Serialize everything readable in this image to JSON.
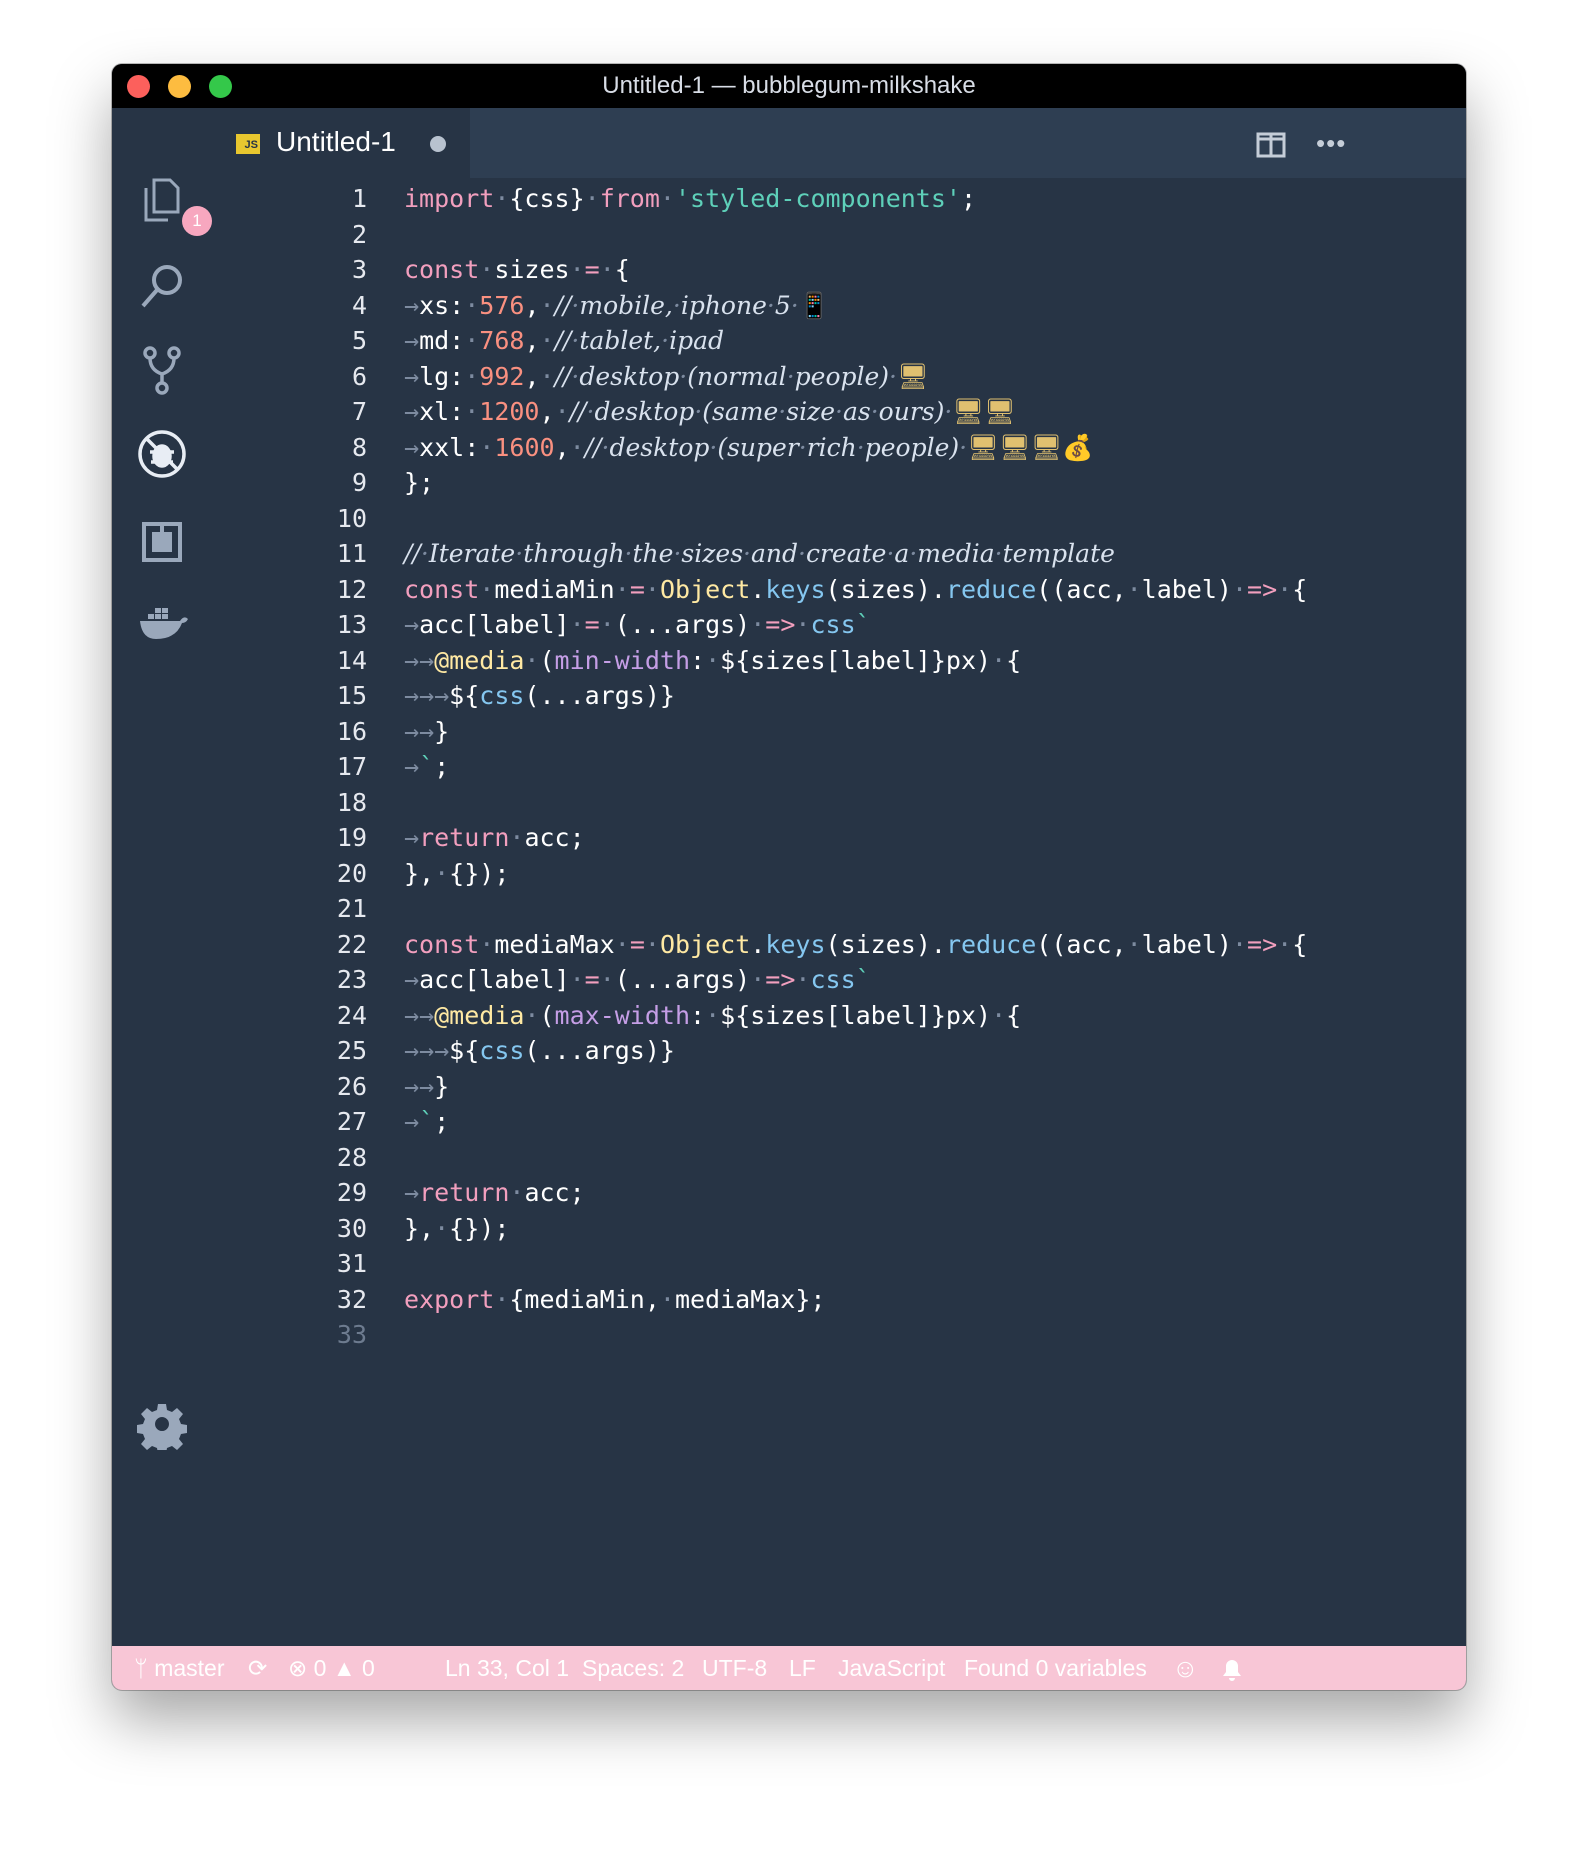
{
  "window": {
    "title": "Untitled-1 — bubblegum-milkshake"
  },
  "activity_bar": {
    "explorer_badge": "1",
    "icons": [
      "files-icon",
      "search-icon",
      "source-control-icon",
      "debug-icon",
      "extensions-icon",
      "docker-icon",
      "gear-icon"
    ]
  },
  "tab": {
    "label": "Untitled-1",
    "lang_badge": "JS"
  },
  "editor": {
    "lines": [
      {
        "n": "1",
        "t": "import·{css}·from·'styled-components';"
      },
      {
        "n": "2",
        "t": ""
      },
      {
        "n": "3",
        "t": "const·sizes·=·{"
      },
      {
        "n": "4",
        "t": "→xs:·576,·//·mobile,·iphone·5·📱"
      },
      {
        "n": "5",
        "t": "→md:·768,·//·tablet,·ipad"
      },
      {
        "n": "6",
        "t": "→lg:·992,·//·desktop·(normal·people)·🖥"
      },
      {
        "n": "7",
        "t": "→xl:·1200,·//·desktop·(same·size·as·ours)·🖥🖥"
      },
      {
        "n": "8",
        "t": "→xxl:·1600,·//·desktop·(super·rich·people)·🖥🖥🖥💰"
      },
      {
        "n": "9",
        "t": "};"
      },
      {
        "n": "10",
        "t": ""
      },
      {
        "n": "11",
        "t": "//·Iterate·through·the·sizes·and·create·a·media·template"
      },
      {
        "n": "12",
        "t": "const·mediaMin·=·Object.keys(sizes).reduce((acc,·label)·=>·{"
      },
      {
        "n": "13",
        "t": "→acc[label]·=·(...args)·=>·css`"
      },
      {
        "n": "14",
        "t": "→→@media·(min-width:·${sizes[label]}px)·{"
      },
      {
        "n": "15",
        "t": "→→→${css(...args)}"
      },
      {
        "n": "16",
        "t": "→→}"
      },
      {
        "n": "17",
        "t": "→`;"
      },
      {
        "n": "18",
        "t": ""
      },
      {
        "n": "19",
        "t": "→return·acc;"
      },
      {
        "n": "20",
        "t": "},·{});"
      },
      {
        "n": "21",
        "t": ""
      },
      {
        "n": "22",
        "t": "const·mediaMax·=·Object.keys(sizes).reduce((acc,·label)·=>·{"
      },
      {
        "n": "23",
        "t": "→acc[label]·=·(...args)·=>·css`"
      },
      {
        "n": "24",
        "t": "→→@media·(max-width:·${sizes[label]}px)·{"
      },
      {
        "n": "25",
        "t": "→→→${css(...args)}"
      },
      {
        "n": "26",
        "t": "→→}"
      },
      {
        "n": "27",
        "t": "→`;"
      },
      {
        "n": "28",
        "t": ""
      },
      {
        "n": "29",
        "t": "→return·acc;"
      },
      {
        "n": "30",
        "t": "},·{});"
      },
      {
        "n": "31",
        "t": ""
      },
      {
        "n": "32",
        "t": "export·{mediaMin,·mediaMax};"
      },
      {
        "n": "33",
        "t": ""
      }
    ]
  },
  "status_bar": {
    "branch": "master",
    "errors": "0",
    "warnings": "0",
    "position": "Ln 33, Col 1",
    "spaces": "Spaces: 2",
    "encoding": "UTF-8",
    "eol": "LF",
    "language": "JavaScript",
    "variables": "Found 0 variables"
  },
  "colors": {
    "titlebar": "#000000",
    "editor_bg": "#273445",
    "tabbar_bg": "#2e3e52",
    "statusbar": "#f8c6d6",
    "keyword": "#f29fbe",
    "string": "#5ed0b9",
    "number": "#f99080",
    "function": "#85c7f0",
    "object": "#ffe9a3",
    "property": "#c59ee6"
  }
}
